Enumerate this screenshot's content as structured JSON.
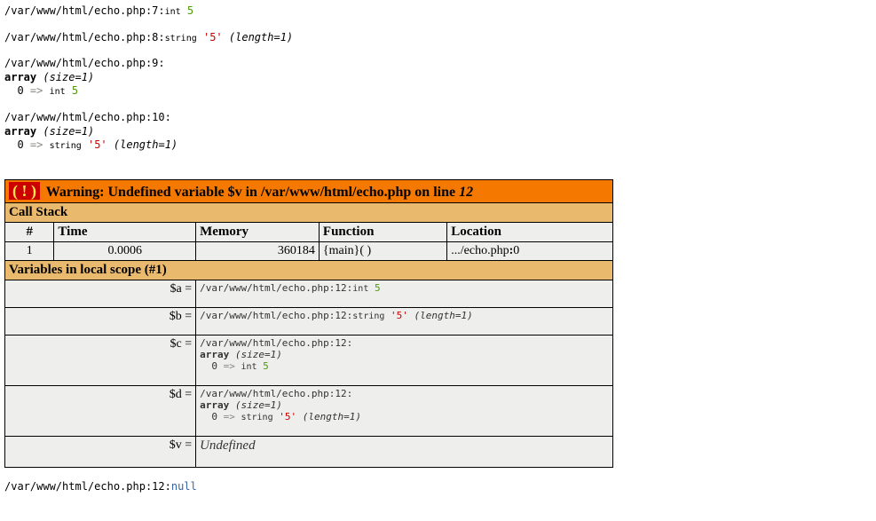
{
  "dumps": [
    {
      "prefix": "/var/www/html/echo.php:7:",
      "type": "int",
      "value": "5"
    },
    {
      "prefix": "/var/www/html/echo.php:8:",
      "type": "string",
      "value": "'5'",
      "length": "(length=1)"
    },
    {
      "prefix": "/var/www/html/echo.php:9:",
      "array_size": "(size=1)",
      "items": [
        {
          "key": "0",
          "type": "int",
          "value": "5"
        }
      ]
    },
    {
      "prefix": "/var/www/html/echo.php:10:",
      "array_size": "(size=1)",
      "items": [
        {
          "key": "0",
          "type": "string",
          "value": "'5'",
          "length": "(length=1)"
        }
      ]
    }
  ],
  "error": {
    "bang": "( ! )",
    "title_prefix": "Warning: Undefined variable $v in /var/www/html/echo.php on line ",
    "line": "12",
    "callstack_label": "Call Stack",
    "cols": {
      "num": "#",
      "time": "Time",
      "memory": "Memory",
      "function": "Function",
      "location": "Location"
    },
    "rows": [
      {
        "num": "1",
        "time": "0.0006",
        "memory": "360184",
        "function": "{main}( )",
        "location_pre": ".../echo.php",
        "location_b": ":",
        "location_post": "0"
      }
    ],
    "scope_label": "Variables in local scope (#1)",
    "vars": [
      {
        "name": "$a =",
        "prefix": "/var/www/html/echo.php:12:",
        "type": "int",
        "value": "5"
      },
      {
        "name": "$b =",
        "prefix": "/var/www/html/echo.php:12:",
        "type": "string",
        "value": "'5'",
        "length": "(length=1)"
      },
      {
        "name": "$c =",
        "prefix": "/var/www/html/echo.php:12:",
        "array_size": "(size=1)",
        "items": [
          {
            "key": "0",
            "type": "int",
            "value": "5"
          }
        ]
      },
      {
        "name": "$d =",
        "prefix": "/var/www/html/echo.php:12:",
        "array_size": "(size=1)",
        "items": [
          {
            "key": "0",
            "type": "string",
            "value": "'5'",
            "length": "(length=1)"
          }
        ]
      },
      {
        "name": "$v =",
        "undefined": "Undefined"
      }
    ]
  },
  "trailing": {
    "prefix": "/var/www/html/echo.php:12:",
    "value": "null"
  },
  "labels": {
    "array": "array",
    "arrow": "=>"
  }
}
